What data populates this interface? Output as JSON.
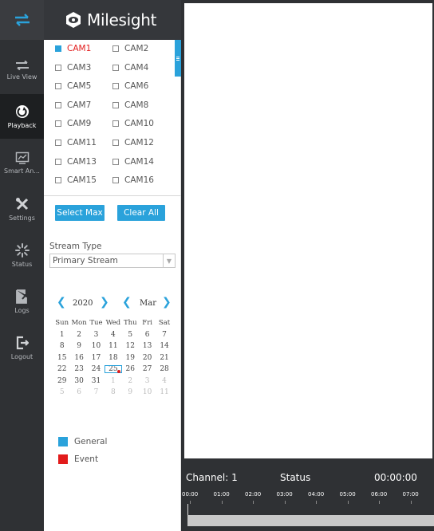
{
  "brand": {
    "name": "Milesight"
  },
  "nav": {
    "items": [
      {
        "label": "Live View",
        "icon": "live-view-icon"
      },
      {
        "label": "Playback",
        "icon": "playback-icon"
      },
      {
        "label": "Smart An...",
        "icon": "smart-analytics-icon"
      },
      {
        "label": "Settings",
        "icon": "settings-icon"
      },
      {
        "label": "Status",
        "icon": "status-icon"
      },
      {
        "label": "Logs",
        "icon": "logs-icon"
      },
      {
        "label": "Logout",
        "icon": "logout-icon"
      }
    ],
    "active": "Playback"
  },
  "cameras": [
    {
      "label": "CAM1",
      "checked": true
    },
    {
      "label": "CAM2",
      "checked": false
    },
    {
      "label": "CAM3",
      "checked": false
    },
    {
      "label": "CAM4",
      "checked": false
    },
    {
      "label": "CAM5",
      "checked": false
    },
    {
      "label": "CAM6",
      "checked": false
    },
    {
      "label": "CAM7",
      "checked": false
    },
    {
      "label": "CAM8",
      "checked": false
    },
    {
      "label": "CAM9",
      "checked": false
    },
    {
      "label": "CAM10",
      "checked": false
    },
    {
      "label": "CAM11",
      "checked": false
    },
    {
      "label": "CAM12",
      "checked": false
    },
    {
      "label": "CAM13",
      "checked": false
    },
    {
      "label": "CAM14",
      "checked": false
    },
    {
      "label": "CAM15",
      "checked": false
    },
    {
      "label": "CAM16",
      "checked": false
    }
  ],
  "buttons": {
    "select_max": "Select Max",
    "clear_all": "Clear All"
  },
  "stream": {
    "label": "Stream Type",
    "value": "Primary Stream"
  },
  "calendar": {
    "year": "2020",
    "month": "Mar",
    "weekdays": [
      "Sun",
      "Mon",
      "Tue",
      "Wed",
      "Thu",
      "Fri",
      "Sat"
    ],
    "weeks": [
      [
        {
          "d": "1"
        },
        {
          "d": "2"
        },
        {
          "d": "3"
        },
        {
          "d": "4"
        },
        {
          "d": "5"
        },
        {
          "d": "6"
        },
        {
          "d": "7"
        }
      ],
      [
        {
          "d": "8"
        },
        {
          "d": "9"
        },
        {
          "d": "10"
        },
        {
          "d": "11"
        },
        {
          "d": "12"
        },
        {
          "d": "13"
        },
        {
          "d": "14"
        }
      ],
      [
        {
          "d": "15"
        },
        {
          "d": "16"
        },
        {
          "d": "17"
        },
        {
          "d": "18"
        },
        {
          "d": "19"
        },
        {
          "d": "20"
        },
        {
          "d": "21"
        }
      ],
      [
        {
          "d": "22"
        },
        {
          "d": "23"
        },
        {
          "d": "24"
        },
        {
          "d": "25",
          "selected": true,
          "event": true
        },
        {
          "d": "26"
        },
        {
          "d": "27"
        },
        {
          "d": "28"
        }
      ],
      [
        {
          "d": "29"
        },
        {
          "d": "30"
        },
        {
          "d": "31"
        },
        {
          "d": "1",
          "other": true
        },
        {
          "d": "2",
          "other": true
        },
        {
          "d": "3",
          "other": true
        },
        {
          "d": "4",
          "other": true
        }
      ],
      [
        {
          "d": "5",
          "other": true
        },
        {
          "d": "6",
          "other": true
        },
        {
          "d": "7",
          "other": true
        },
        {
          "d": "8",
          "other": true
        },
        {
          "d": "9",
          "other": true
        },
        {
          "d": "10",
          "other": true
        },
        {
          "d": "11",
          "other": true
        }
      ]
    ]
  },
  "legend": [
    {
      "label": "General",
      "color": "#2aa2db"
    },
    {
      "label": "Event",
      "color": "#e21b1b"
    }
  ],
  "timeline": {
    "channel": "Channel: 1",
    "status": "Status",
    "time": "00:00:00",
    "ticks": [
      "00:00",
      "01:00",
      "02:00",
      "03:00",
      "04:00",
      "05:00",
      "06:00",
      "07:00"
    ]
  },
  "colors": {
    "accent": "#2aa2db",
    "event": "#e21b1b",
    "sidebar": "#2f3134"
  }
}
